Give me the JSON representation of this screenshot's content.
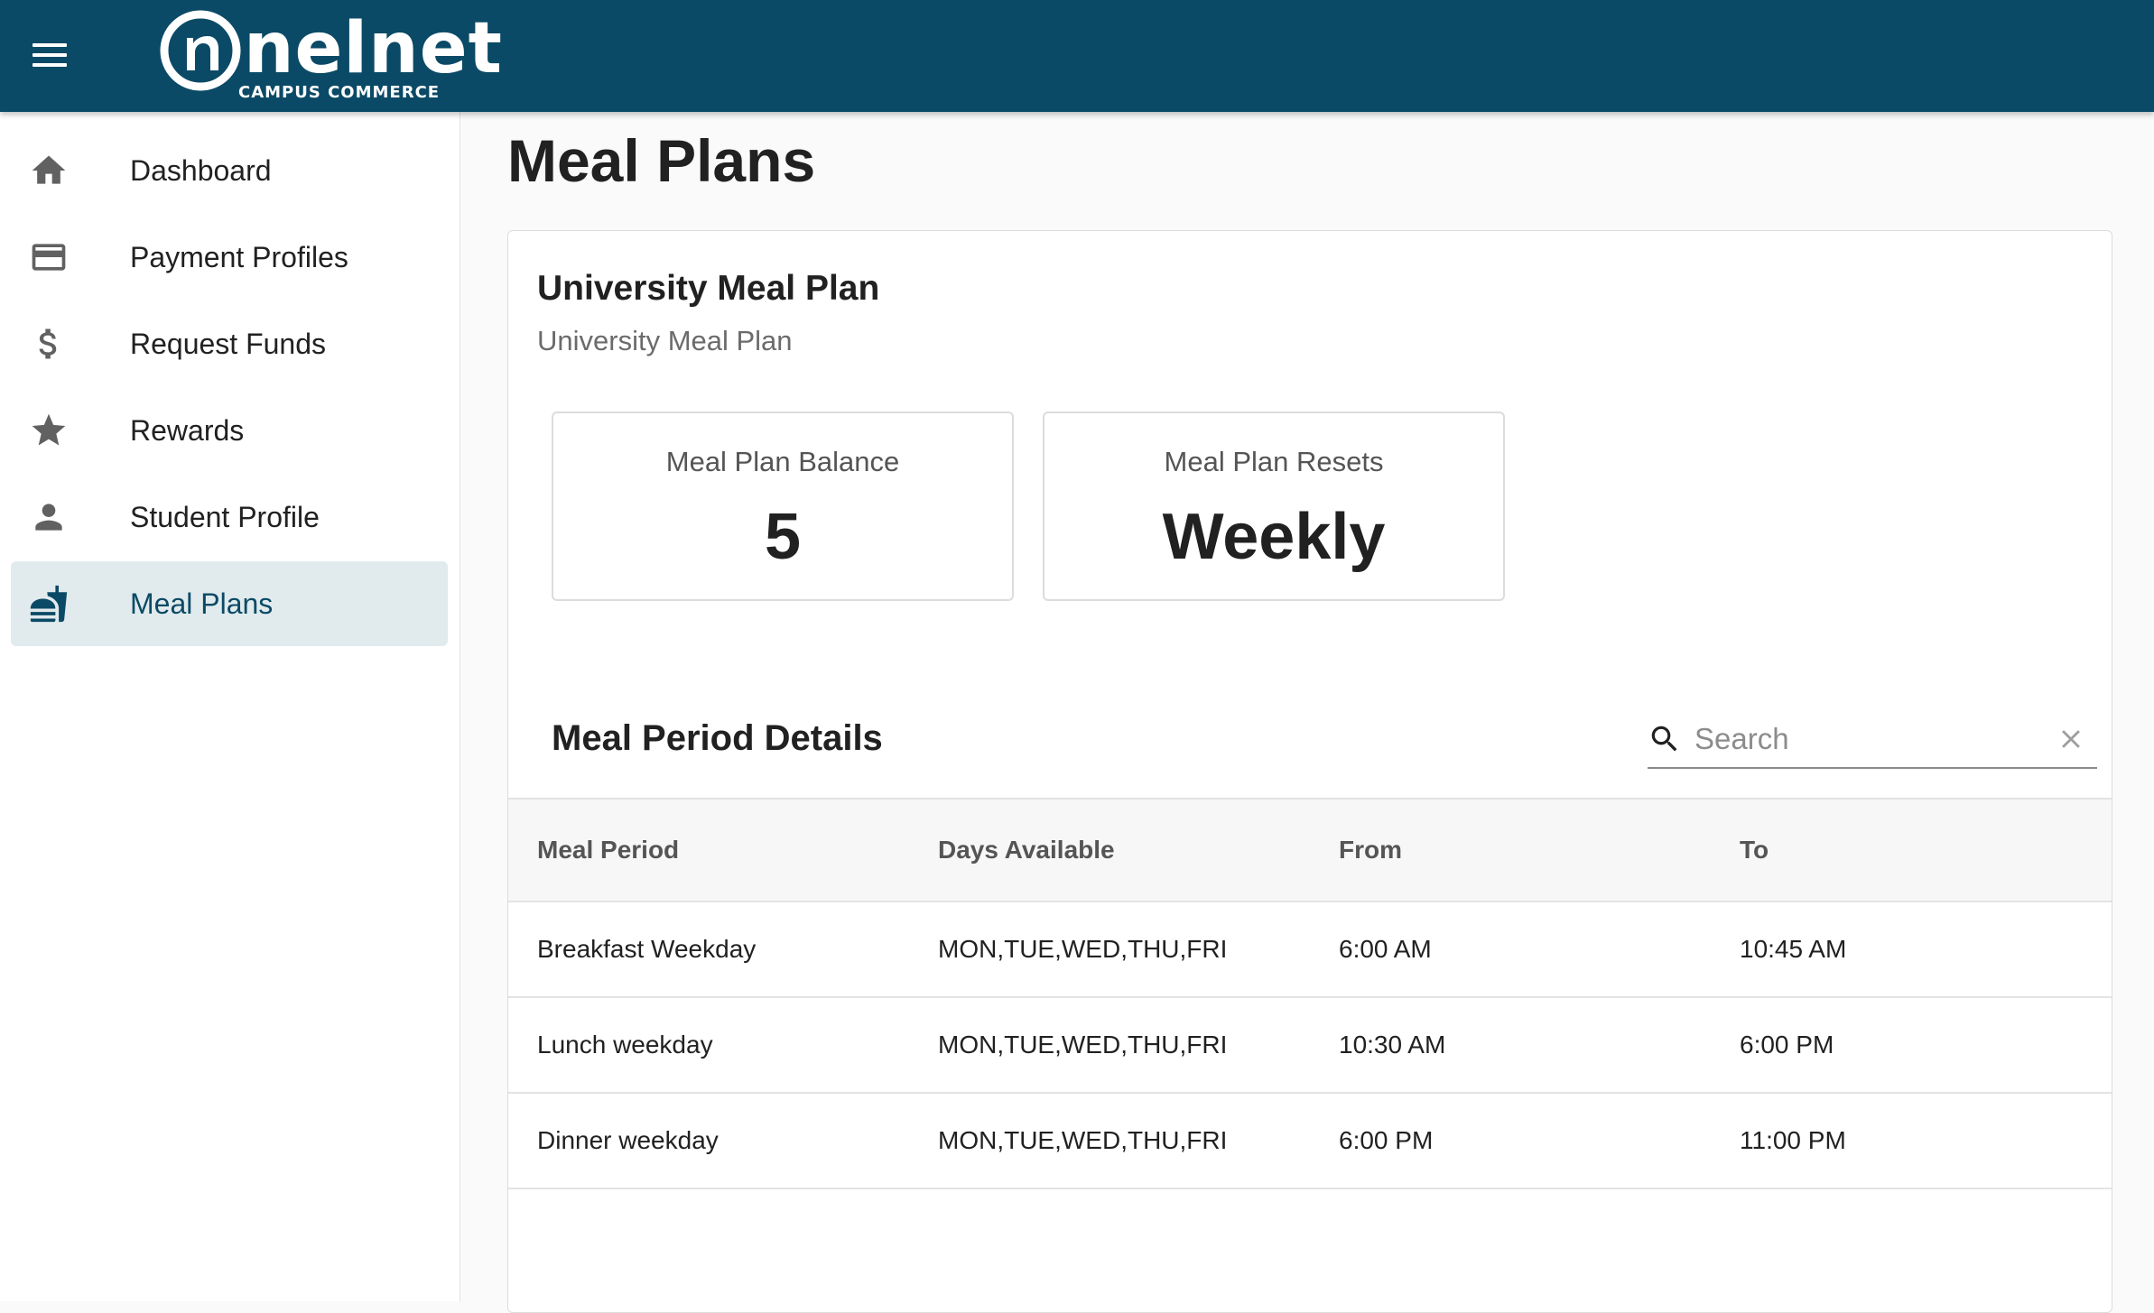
{
  "header": {
    "logo_wordmark": "nelnet",
    "logo_subtitle": "CAMPUS COMMERCE",
    "brand_color": "#0b4a66"
  },
  "sidebar": {
    "items": [
      {
        "label": "Dashboard",
        "icon": "home-icon"
      },
      {
        "label": "Payment Profiles",
        "icon": "credit-card-icon"
      },
      {
        "label": "Request Funds",
        "icon": "dollar-icon"
      },
      {
        "label": "Rewards",
        "icon": "star-icon"
      },
      {
        "label": "Student Profile",
        "icon": "person-icon"
      },
      {
        "label": "Meal Plans",
        "icon": "fastfood-icon",
        "active": true
      }
    ],
    "active_bg": "#e1ebed"
  },
  "main": {
    "page_title": "Meal Plans",
    "plan": {
      "title": "University Meal Plan",
      "subtitle": "University Meal Plan",
      "balance_label": "Meal Plan Balance",
      "balance_value": "5",
      "resets_label": "Meal Plan Resets",
      "resets_value": "Weekly"
    },
    "periods": {
      "title": "Meal Period Details",
      "search_placeholder": "Search",
      "search_value": "",
      "columns": [
        "Meal Period",
        "Days Available",
        "From",
        "To"
      ],
      "rows": [
        [
          "Breakfast Weekday",
          "MON,TUE,WED,THU,FRI",
          "6:00 AM",
          "10:45 AM"
        ],
        [
          "Lunch weekday",
          "MON,TUE,WED,THU,FRI",
          "10:30 AM",
          "6:00 PM"
        ],
        [
          "Dinner weekday",
          "MON,TUE,WED,THU,FRI",
          "6:00 PM",
          "11:00 PM"
        ]
      ]
    }
  }
}
